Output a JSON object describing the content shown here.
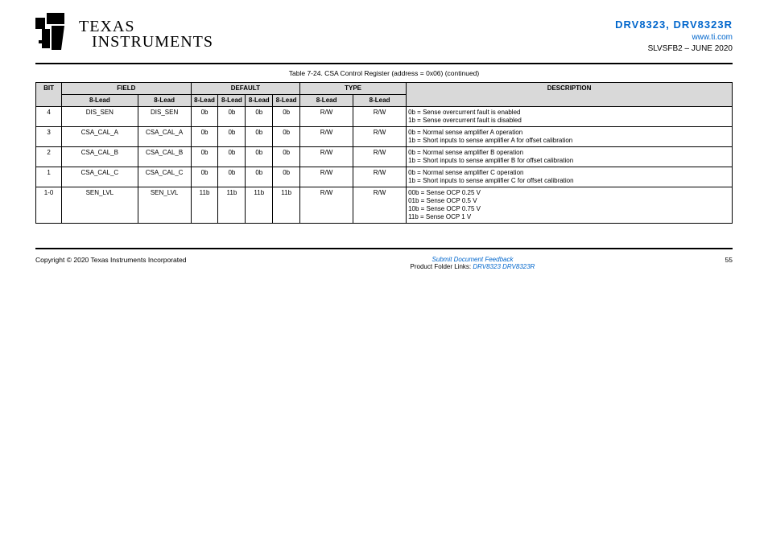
{
  "header": {
    "brand_line1": "TEXAS",
    "brand_line2": "INSTRUMENTS",
    "site": "www.ti.com",
    "part": "DRV8323, DRV8323R",
    "doc": "SLVSFB2 – JUNE 2020"
  },
  "table": {
    "caption": "Table 7-24. CSA Control Register (address = 0x06) (continued)",
    "columns": [
      "BIT",
      "FIELD",
      "TYPE",
      "DEFAULT",
      "DESCRIPTION"
    ],
    "sub_columns": [
      "8-Lead",
      "8-Lead",
      "8-Lead",
      "8-Lead"
    ],
    "rows": [
      {
        "bit": "4",
        "field": "DIS_SEN",
        "type": "R/W",
        "def_a": "0b",
        "def_b": "0b",
        "def_c": "0b",
        "def_d": "0b",
        "name_a": "DIS_SEN",
        "name_b": "DIS_SEN",
        "desc": "0b = Sense overcurrent fault is enabled\n1b = Sense overcurrent fault is disabled"
      },
      {
        "bit": "3",
        "field": "CSA_CAL_A",
        "type": "R/W",
        "def_a": "0b",
        "def_b": "0b",
        "def_c": "0b",
        "def_d": "0b",
        "name_a": "CSA_CAL_A",
        "name_b": "CSA_CAL_A",
        "desc": "0b = Normal sense amplifier A operation\n1b = Short inputs to sense amplifier A for offset calibration"
      },
      {
        "bit": "2",
        "field": "CSA_CAL_B",
        "type": "R/W",
        "def_a": "0b",
        "def_b": "0b",
        "def_c": "0b",
        "def_d": "0b",
        "name_a": "CSA_CAL_B",
        "name_b": "CSA_CAL_B",
        "desc": "0b = Normal sense amplifier B operation\n1b = Short inputs to sense amplifier B for offset calibration"
      },
      {
        "bit": "1",
        "field": "CSA_CAL_C",
        "type": "R/W",
        "def_a": "0b",
        "def_b": "0b",
        "def_c": "0b",
        "def_d": "0b",
        "name_a": "CSA_CAL_C",
        "name_b": "CSA_CAL_C",
        "desc": "0b = Normal sense amplifier C operation\n1b = Short inputs to sense amplifier C for offset calibration"
      },
      {
        "bit": "1-0",
        "field": "SEN_LVL",
        "type": "R/W",
        "def_a": "11b",
        "def_b": "11b",
        "def_c": "11b",
        "def_d": "11b",
        "name_a": "SEN_LVL",
        "name_b": "SEN_LVL",
        "desc": "00b = Sense OCP 0.25 V\n01b = Sense OCP 0.5 V\n10b = Sense OCP 0.75 V\n11b = Sense OCP 1 V"
      }
    ]
  },
  "footer": {
    "copyright": "Copyright © 2020 Texas Instruments Incorporated",
    "note_title": "Submit Document Feedback",
    "page": "55",
    "spec_title": "Product Folder Links:",
    "spec_link": "DRV8323 DRV8323R"
  }
}
